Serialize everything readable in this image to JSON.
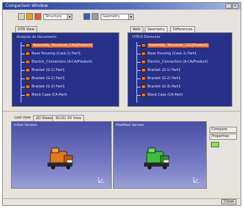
{
  "window": {
    "title": "Comparison Window",
    "buttons": [
      "_",
      "×"
    ]
  },
  "toolbar": {
    "combo_left": "Structure",
    "combo_right": "Geometry",
    "accent": "#e0a21e"
  },
  "left_panel": {
    "tab": "DTR View"
  },
  "right_panel": {
    "tabs": [
      "Refs",
      "Geometry",
      "Differences"
    ]
  },
  "trees": {
    "left": {
      "root": "Analysis de documents",
      "nodes": [
        "Assembly_Structure_CA1[Product]",
        "Base Housing (Case.1) Part1",
        "Electric_Connectors (A-CA/Product)",
        "Bracket (G-1) Part1",
        "Bracket (G-2) Part1",
        "Bracket (G-3) Part1",
        "Block Case (CA-Part)"
      ]
    },
    "right": {
      "root": "DTR-R Elements",
      "nodes": [
        "Assembly_Structure_CA1[Product]",
        "Base Housing (Case.1) Part1",
        "Electric_Connectors (A-CA/Product)",
        "Bracket (G-1) Part1",
        "Bracket (G-2) Part1",
        "Bracket (G-3) Part1",
        "Block Case (CA-Part)"
      ]
    }
  },
  "view_tabs": [
    "Last view",
    "2D Viewer",
    "3D/2D 3D View"
  ],
  "viewports": {
    "left_label": "Initial Version",
    "right_label": "Modified Version"
  },
  "side": {
    "btn1": "Compare",
    "btn2": "Properties"
  },
  "status": {
    "close": "Close"
  },
  "colors": {
    "tree_bg": "#27318a",
    "selected": "#ff6a1a",
    "left_model": "#e0791e",
    "right_model": "#3fbf3a"
  }
}
